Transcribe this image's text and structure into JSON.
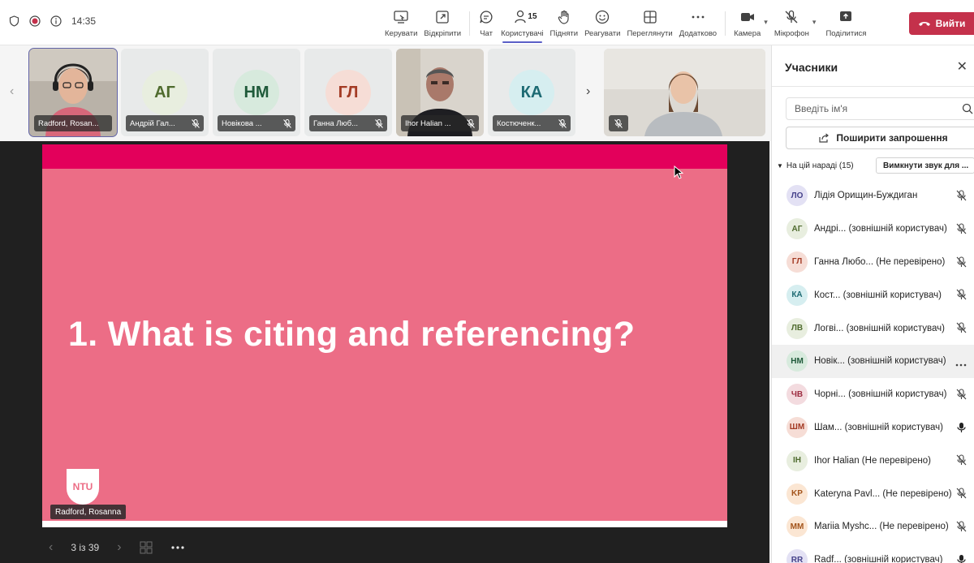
{
  "topbar": {
    "time": "14:35",
    "tools": [
      {
        "label": "Керувати",
        "icon": "share-screen-icon"
      },
      {
        "label": "Відкріпити",
        "icon": "pop-out-icon"
      },
      {
        "label": "Чат",
        "icon": "chat-icon"
      },
      {
        "label": "Користувачі",
        "icon": "people-icon",
        "badge": "15",
        "active": true
      },
      {
        "label": "Підняти",
        "icon": "raise-hand-icon"
      },
      {
        "label": "Реагувати",
        "icon": "smiley-icon"
      },
      {
        "label": "Переглянути",
        "icon": "view-grid-icon"
      },
      {
        "label": "Додатково",
        "icon": "more-icon"
      },
      {
        "label": "Камера",
        "icon": "camera-icon"
      },
      {
        "label": "Мікрофон",
        "icon": "mic-off-icon"
      },
      {
        "label": "Поділитися",
        "icon": "share-icon"
      }
    ],
    "leave_label": "Вийти"
  },
  "thumbnails": [
    {
      "name": "Radford, Rosan...",
      "type": "video",
      "selected": true
    },
    {
      "name": "Андрій Гал...",
      "initials": "АГ",
      "bg": "#e8eedf",
      "fg": "#4f6b2e",
      "muted": true
    },
    {
      "name": "Новікова ...",
      "initials": "НМ",
      "bg": "#d7eadd",
      "fg": "#1f5a3a",
      "muted": true
    },
    {
      "name": "Ганна Люб...",
      "initials": "ГЛ",
      "bg": "#f6ddd6",
      "fg": "#a33b25",
      "muted": true
    },
    {
      "name": "Ihor Halian ...",
      "type": "video",
      "muted": true
    },
    {
      "name": "Костюченк...",
      "initials": "КА",
      "bg": "#d6eef0",
      "fg": "#1d6a73",
      "muted": true
    }
  ],
  "slide": {
    "title": "1. What is citing and referencing?",
    "logo": "NTU",
    "presenter": "Radford, Rosanna",
    "counter": "3 із 39"
  },
  "panel": {
    "title": "Учасники",
    "search_placeholder": "Введіть ім'я",
    "invite_label": "Поширити запрошення",
    "section_label": "На цій нараді (15)",
    "mute_all_label": "Вимкнути звук для ...",
    "participants": [
      {
        "initials": "ЛО",
        "name": "Лідія Орищин-Буждиган",
        "bg": "#e3e1f4",
        "fg": "#45418a",
        "status": "muted"
      },
      {
        "initials": "АГ",
        "name": "Андрі... (зовнішній користувач)",
        "bg": "#e8eedf",
        "fg": "#4f6b2e",
        "status": "muted"
      },
      {
        "initials": "ГЛ",
        "name": "Ганна Любо... (Не перевірено)",
        "bg": "#f6ddd6",
        "fg": "#a33b25",
        "status": "muted"
      },
      {
        "initials": "КА",
        "name": "Кост... (зовнішній користувач)",
        "bg": "#d6eef0",
        "fg": "#1d6a73",
        "status": "muted"
      },
      {
        "initials": "ЛВ",
        "name": "Логві... (зовнішній користувач)",
        "bg": "#e8eedf",
        "fg": "#4f6b2e",
        "status": "muted"
      },
      {
        "initials": "НМ",
        "name": "Новік... (зовнішній користувач)",
        "bg": "#d7eadd",
        "fg": "#1f5a3a",
        "status": "more"
      },
      {
        "initials": "ЧВ",
        "name": "Чорні... (зовнішній користувач)",
        "bg": "#f3dbdf",
        "fg": "#9c2b3f",
        "status": "muted"
      },
      {
        "initials": "ШМ",
        "name": "Шам... (зовнішній користувач)",
        "bg": "#f6ddd6",
        "fg": "#a33b25",
        "status": "mic"
      },
      {
        "initials": "IH",
        "name": "Ihor Halian (Не перевірено)",
        "bg": "#e8eedf",
        "fg": "#4f6b2e",
        "status": "muted"
      },
      {
        "initials": "KP",
        "name": "Kateryna Pavl... (Не перевірено)",
        "bg": "#fbe6d3",
        "fg": "#a3541b",
        "status": "muted"
      },
      {
        "initials": "MM",
        "name": "Mariia Myshc... (Не перевірено)",
        "bg": "#fbe6d3",
        "fg": "#a3541b",
        "status": "muted"
      },
      {
        "initials": "RR",
        "name": "Radf... (зовнішній користувач)",
        "bg": "#e3e1f4",
        "fg": "#45418a",
        "status": "mic"
      }
    ]
  }
}
